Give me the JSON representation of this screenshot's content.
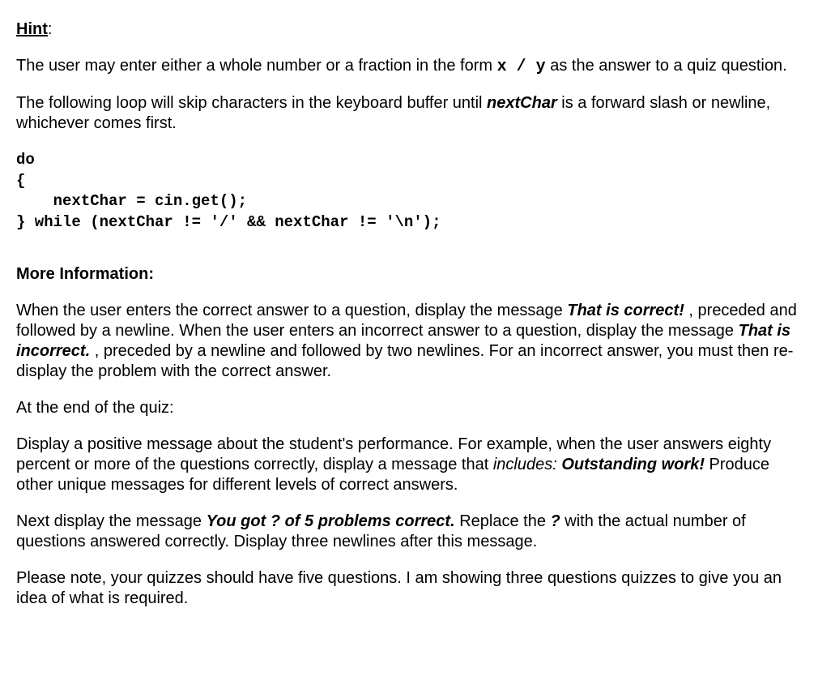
{
  "hint": {
    "label": "Hint",
    "colon": ":",
    "p1_a": "The user may enter either a whole number or a fraction in the form ",
    "p1_x": "x",
    "p1_slash": " / ",
    "p1_y": "y",
    "p1_b": " as the answer to a quiz question.",
    "p2_a": "The following loop will skip characters in the keyboard buffer until ",
    "p2_nc": "nextChar",
    "p2_b": " is a forward slash or newline, whichever comes first.",
    "code": "do\n{\n    nextChar = cin.get();\n} while (nextChar != '/' && nextChar != '\\n');"
  },
  "more": {
    "label": "More Information:",
    "p1_a": "When the user enters the correct answer to a question, display the message ",
    "p1_correct": "That is correct!",
    "p1_b": " , preceded and followed by a newline. When the user enters an incorrect answer to a question, display the message ",
    "p1_incorrect": "That is incorrect.",
    "p1_c": " , preceded by a newline and followed by two newlines. For an incorrect answer, you must then re-display the problem with the correct answer.",
    "p2": "At the end of the quiz:",
    "p3_a": "Display a positive message about the student's performance. For example, when the user answers eighty percent or more of the questions correctly, display a message that ",
    "p3_includes": "includes:",
    "p3_space": " ",
    "p3_outstanding": "Outstanding work!",
    "p3_b": " Produce other unique messages for different levels of correct answers.",
    "p4_a": "Next display the message ",
    "p4_yougot": "You got ? of 5 problems correct.",
    "p4_b": " Replace the ",
    "p4_q": "?",
    "p4_c": " with the actual number of questions answered correctly. Display three newlines after this message.",
    "p5": "Please note, your quizzes should have five questions. I am showing three questions quizzes to give you an idea of what is required."
  }
}
